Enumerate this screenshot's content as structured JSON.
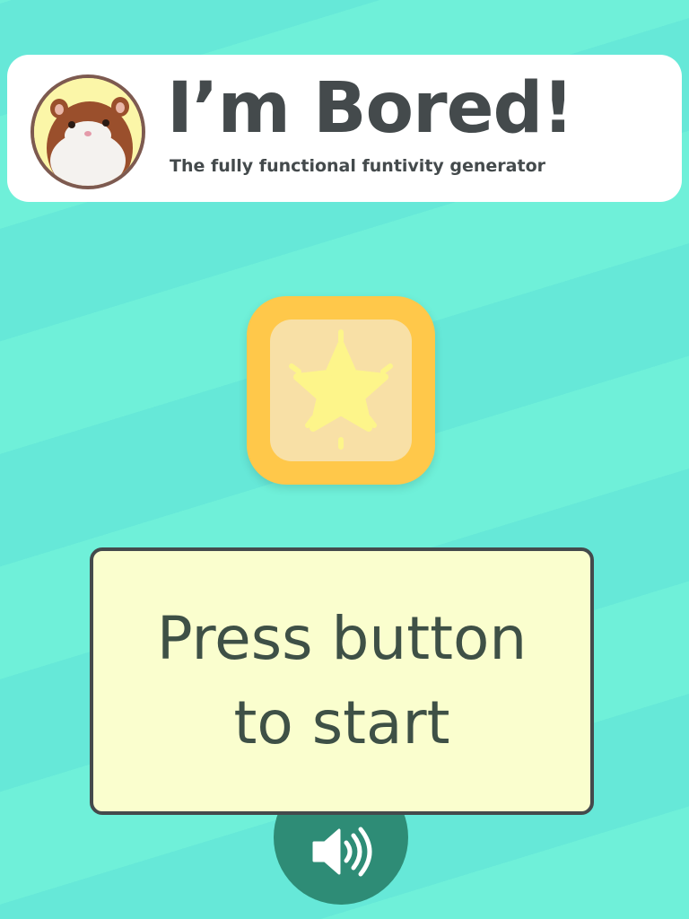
{
  "app": {
    "title": "I’m Bored!",
    "subtitle": "The fully functional funtivity generator"
  },
  "header": {
    "avatar_icon": "hamster-avatar"
  },
  "start_button": {
    "icon": "star-icon"
  },
  "message": {
    "line1": "Press button",
    "line2": "to start"
  },
  "sound_button": {
    "icon": "speaker-volume-icon"
  },
  "colors": {
    "background": "#6ff0d9",
    "header_bg": "#ffffff",
    "title_text": "#444a4c",
    "star_button_outer": "#ffc84a",
    "star_button_inner": "#f8e0a6",
    "star": "#fdf58a",
    "message_bg": "#fafece",
    "message_text": "#3e5046",
    "sound_button": "#2e8c76"
  }
}
